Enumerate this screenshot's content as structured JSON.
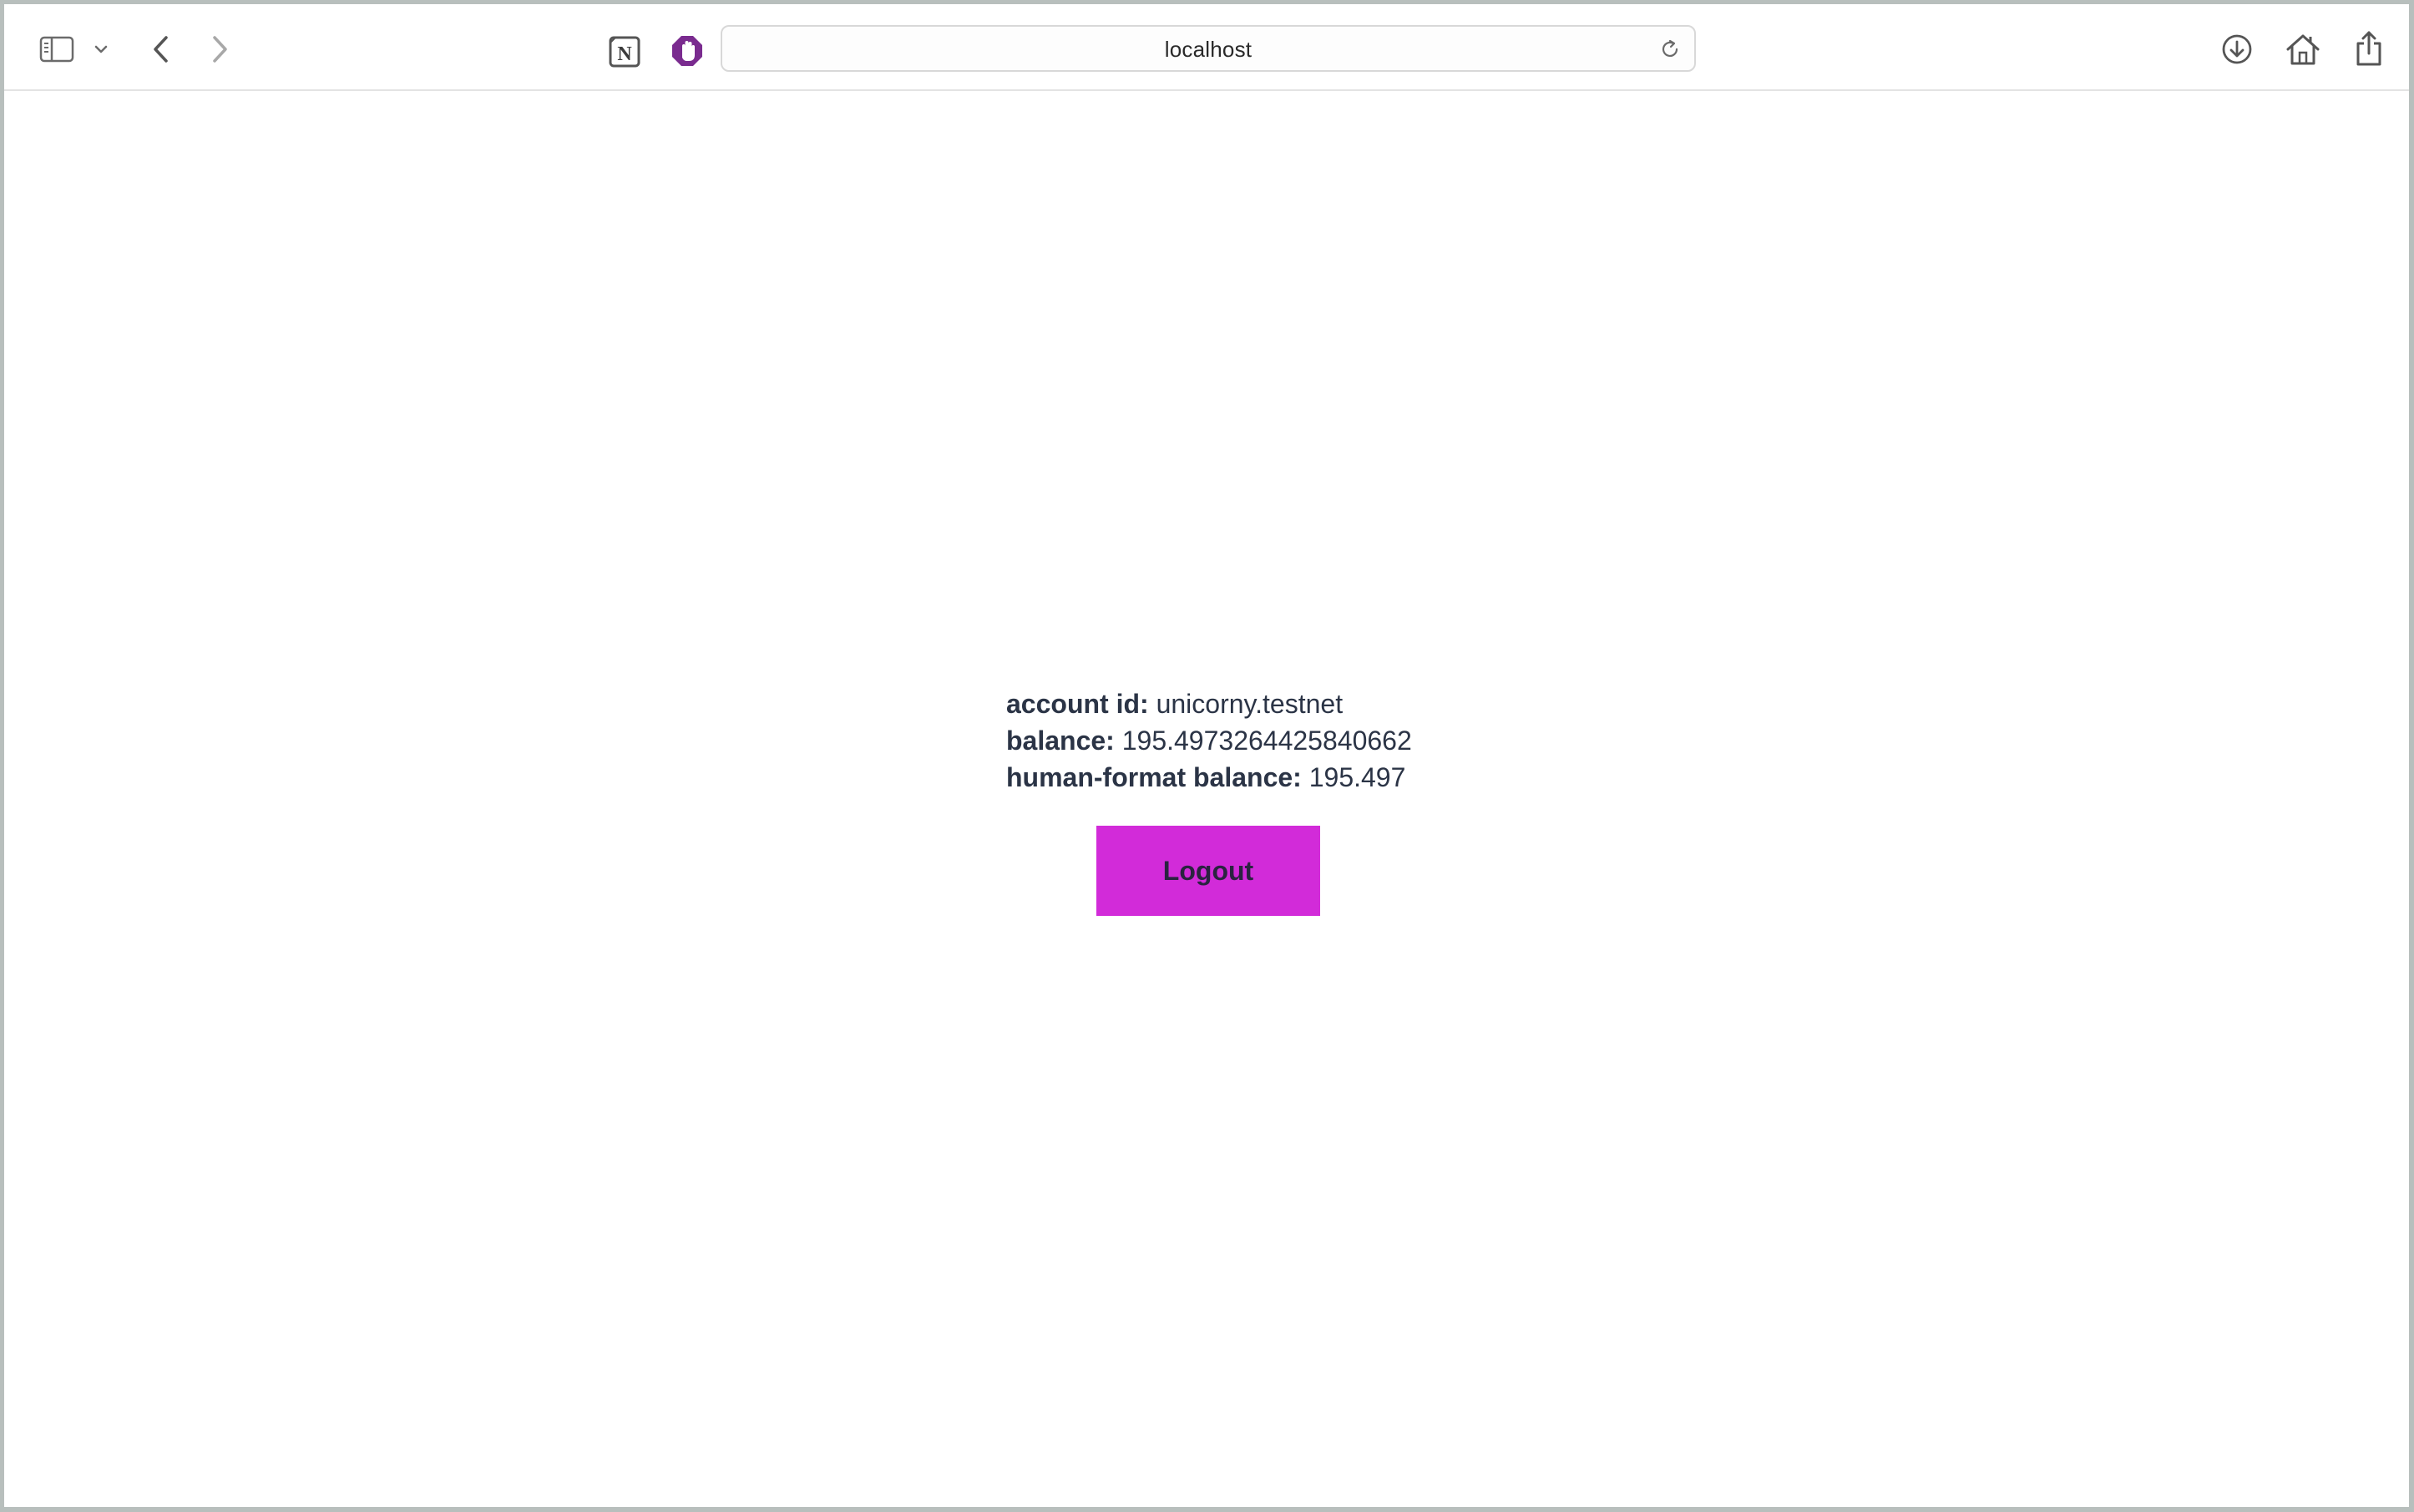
{
  "browser": {
    "address": "localhost",
    "icons": {
      "sidebar": "sidebar-icon",
      "sidebar_menu": "chevron-down-icon",
      "back": "chevron-left-icon",
      "forward": "chevron-right-icon",
      "notion": "notion-icon",
      "adblock": "hand-stop-icon",
      "reload": "reload-icon",
      "download": "download-icon",
      "home": "home-icon",
      "share": "share-icon"
    },
    "notion_letter": "N"
  },
  "account": {
    "account_id_label": "account id:",
    "account_id_value": "unicorny.testnet",
    "balance_label": "balance:",
    "balance_value": "195.4973264425840662",
    "human_balance_label": "human-format balance:",
    "human_balance_value": "195.497"
  },
  "actions": {
    "logout_label": "Logout"
  },
  "colors": {
    "logout_button": "#d22bd9",
    "text": "#2b3446",
    "adblock_accent": "#7a2b8f"
  }
}
